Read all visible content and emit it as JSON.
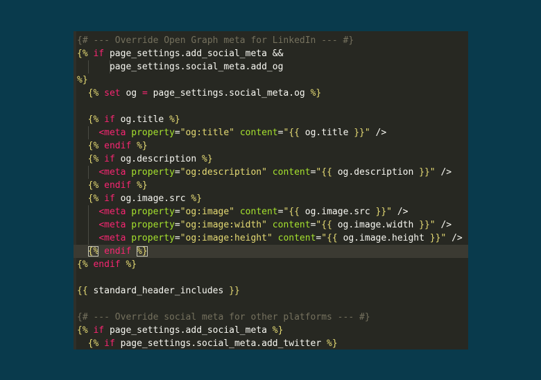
{
  "editor": {
    "lines": [
      {
        "indent": 0,
        "tokens": [
          {
            "t": "{# --- Override Open Graph meta for LinkedIn --- #}",
            "c": "comment"
          }
        ]
      },
      {
        "indent": 0,
        "tokens": [
          {
            "t": "{%",
            "c": "delim"
          },
          {
            "t": " ",
            "c": "var"
          },
          {
            "t": "if",
            "c": "kw"
          },
          {
            "t": " page_settings.add_social_meta ",
            "c": "var"
          },
          {
            "t": "&&",
            "c": "var"
          }
        ]
      },
      {
        "indent": 0,
        "guides": [
          2,
          6
        ],
        "tokens": [
          {
            "t": "      page_settings.social_meta.add_og",
            "c": "var"
          }
        ]
      },
      {
        "indent": 0,
        "tokens": [
          {
            "t": "%}",
            "c": "delim"
          }
        ]
      },
      {
        "indent": 0,
        "tokens": [
          {
            "t": "  ",
            "c": "var"
          },
          {
            "t": "{%",
            "c": "delim"
          },
          {
            "t": " ",
            "c": "var"
          },
          {
            "t": "set",
            "c": "kw"
          },
          {
            "t": " og ",
            "c": "var"
          },
          {
            "t": "=",
            "c": "op"
          },
          {
            "t": " page_settings.social_meta.og ",
            "c": "var"
          },
          {
            "t": "%}",
            "c": "delim"
          }
        ]
      },
      {
        "indent": 0,
        "tokens": [
          {
            "t": " ",
            "c": "var"
          }
        ]
      },
      {
        "indent": 0,
        "tokens": [
          {
            "t": "  ",
            "c": "var"
          },
          {
            "t": "{%",
            "c": "delim"
          },
          {
            "t": " ",
            "c": "var"
          },
          {
            "t": "if",
            "c": "kw"
          },
          {
            "t": " og.title ",
            "c": "var"
          },
          {
            "t": "%}",
            "c": "delim"
          }
        ]
      },
      {
        "indent": 0,
        "guides": [
          2
        ],
        "tokens": [
          {
            "t": "    ",
            "c": "var"
          },
          {
            "t": "<meta",
            "c": "tag"
          },
          {
            "t": " ",
            "c": "var"
          },
          {
            "t": "property",
            "c": "attr"
          },
          {
            "t": "=",
            "c": "punct"
          },
          {
            "t": "\"og:title\"",
            "c": "str"
          },
          {
            "t": " ",
            "c": "var"
          },
          {
            "t": "content",
            "c": "attr"
          },
          {
            "t": "=",
            "c": "punct"
          },
          {
            "t": "\"{{ ",
            "c": "str"
          },
          {
            "t": "og.title",
            "c": "var"
          },
          {
            "t": " }}\"",
            "c": "str"
          },
          {
            "t": " />",
            "c": "punct"
          }
        ]
      },
      {
        "indent": 0,
        "tokens": [
          {
            "t": "  ",
            "c": "var"
          },
          {
            "t": "{%",
            "c": "delim"
          },
          {
            "t": " ",
            "c": "var"
          },
          {
            "t": "endif",
            "c": "kw"
          },
          {
            "t": " ",
            "c": "var"
          },
          {
            "t": "%}",
            "c": "delim"
          }
        ]
      },
      {
        "indent": 0,
        "tokens": [
          {
            "t": "  ",
            "c": "var"
          },
          {
            "t": "{%",
            "c": "delim"
          },
          {
            "t": " ",
            "c": "var"
          },
          {
            "t": "if",
            "c": "kw"
          },
          {
            "t": " og.description ",
            "c": "var"
          },
          {
            "t": "%}",
            "c": "delim"
          }
        ]
      },
      {
        "indent": 0,
        "guides": [
          2
        ],
        "tokens": [
          {
            "t": "    ",
            "c": "var"
          },
          {
            "t": "<meta",
            "c": "tag"
          },
          {
            "t": " ",
            "c": "var"
          },
          {
            "t": "property",
            "c": "attr"
          },
          {
            "t": "=",
            "c": "punct"
          },
          {
            "t": "\"og:description\"",
            "c": "str"
          },
          {
            "t": " ",
            "c": "var"
          },
          {
            "t": "content",
            "c": "attr"
          },
          {
            "t": "=",
            "c": "punct"
          },
          {
            "t": "\"{{ ",
            "c": "str"
          },
          {
            "t": "og.description",
            "c": "var"
          },
          {
            "t": " }}\"",
            "c": "str"
          },
          {
            "t": " />",
            "c": "punct"
          }
        ]
      },
      {
        "indent": 0,
        "tokens": [
          {
            "t": "  ",
            "c": "var"
          },
          {
            "t": "{%",
            "c": "delim"
          },
          {
            "t": " ",
            "c": "var"
          },
          {
            "t": "endif",
            "c": "kw"
          },
          {
            "t": " ",
            "c": "var"
          },
          {
            "t": "%}",
            "c": "delim"
          }
        ]
      },
      {
        "indent": 0,
        "tokens": [
          {
            "t": "  ",
            "c": "var"
          },
          {
            "t": "{%",
            "c": "delim"
          },
          {
            "t": " ",
            "c": "var"
          },
          {
            "t": "if",
            "c": "kw"
          },
          {
            "t": " og.image.src ",
            "c": "var"
          },
          {
            "t": "%}",
            "c": "delim"
          }
        ]
      },
      {
        "indent": 0,
        "guides": [
          2
        ],
        "tokens": [
          {
            "t": "    ",
            "c": "var"
          },
          {
            "t": "<meta",
            "c": "tag"
          },
          {
            "t": " ",
            "c": "var"
          },
          {
            "t": "property",
            "c": "attr"
          },
          {
            "t": "=",
            "c": "punct"
          },
          {
            "t": "\"og:image\"",
            "c": "str"
          },
          {
            "t": " ",
            "c": "var"
          },
          {
            "t": "content",
            "c": "attr"
          },
          {
            "t": "=",
            "c": "punct"
          },
          {
            "t": "\"{{ ",
            "c": "str"
          },
          {
            "t": "og.image.src",
            "c": "var"
          },
          {
            "t": " }}\"",
            "c": "str"
          },
          {
            "t": " />",
            "c": "punct"
          }
        ]
      },
      {
        "indent": 0,
        "guides": [
          2
        ],
        "tokens": [
          {
            "t": "    ",
            "c": "var"
          },
          {
            "t": "<meta",
            "c": "tag"
          },
          {
            "t": " ",
            "c": "var"
          },
          {
            "t": "property",
            "c": "attr"
          },
          {
            "t": "=",
            "c": "punct"
          },
          {
            "t": "\"og:image:width\"",
            "c": "str"
          },
          {
            "t": " ",
            "c": "var"
          },
          {
            "t": "content",
            "c": "attr"
          },
          {
            "t": "=",
            "c": "punct"
          },
          {
            "t": "\"{{ ",
            "c": "str"
          },
          {
            "t": "og.image.width",
            "c": "var"
          },
          {
            "t": " }}\"",
            "c": "str"
          },
          {
            "t": " />",
            "c": "punct"
          }
        ]
      },
      {
        "indent": 0,
        "guides": [
          2
        ],
        "tokens": [
          {
            "t": "    ",
            "c": "var"
          },
          {
            "t": "<meta",
            "c": "tag"
          },
          {
            "t": " ",
            "c": "var"
          },
          {
            "t": "property",
            "c": "attr"
          },
          {
            "t": "=",
            "c": "punct"
          },
          {
            "t": "\"og:image:height\"",
            "c": "str"
          },
          {
            "t": " ",
            "c": "var"
          },
          {
            "t": "content",
            "c": "attr"
          },
          {
            "t": "=",
            "c": "punct"
          },
          {
            "t": "\"{{ ",
            "c": "str"
          },
          {
            "t": "og.image.height",
            "c": "var"
          },
          {
            "t": " }}\"",
            "c": "str"
          },
          {
            "t": " />",
            "c": "punct"
          }
        ]
      },
      {
        "indent": 0,
        "current": true,
        "tokens": [
          {
            "t": "  ",
            "c": "var"
          },
          {
            "t": "{%",
            "c": "delim",
            "match": true
          },
          {
            "t": " ",
            "c": "var"
          },
          {
            "t": "endif",
            "c": "kw"
          },
          {
            "t": " ",
            "c": "var"
          },
          {
            "t": "%}",
            "c": "delim",
            "match": true
          }
        ]
      },
      {
        "indent": 0,
        "tokens": [
          {
            "t": "{%",
            "c": "delim"
          },
          {
            "t": " ",
            "c": "var"
          },
          {
            "t": "endif",
            "c": "kw"
          },
          {
            "t": " ",
            "c": "var"
          },
          {
            "t": "%}",
            "c": "delim"
          }
        ]
      },
      {
        "indent": 0,
        "tokens": [
          {
            "t": " ",
            "c": "var"
          }
        ]
      },
      {
        "indent": 0,
        "tokens": [
          {
            "t": "{{",
            "c": "delim"
          },
          {
            "t": " standard_header_includes ",
            "c": "var"
          },
          {
            "t": "}}",
            "c": "delim"
          }
        ]
      },
      {
        "indent": 0,
        "tokens": [
          {
            "t": " ",
            "c": "var"
          }
        ]
      },
      {
        "indent": 0,
        "tokens": [
          {
            "t": "{# --- Override social meta for other platforms --- #}",
            "c": "comment"
          }
        ]
      },
      {
        "indent": 0,
        "tokens": [
          {
            "t": "{%",
            "c": "delim"
          },
          {
            "t": " ",
            "c": "var"
          },
          {
            "t": "if",
            "c": "kw"
          },
          {
            "t": " page_settings.add_social_meta ",
            "c": "var"
          },
          {
            "t": "%}",
            "c": "delim"
          }
        ]
      },
      {
        "indent": 0,
        "tokens": [
          {
            "t": "  ",
            "c": "var"
          },
          {
            "t": "{%",
            "c": "delim"
          },
          {
            "t": " ",
            "c": "var"
          },
          {
            "t": "if",
            "c": "kw"
          },
          {
            "t": " page_settings.social_meta.add_twitter ",
            "c": "var"
          },
          {
            "t": "%}",
            "c": "delim"
          }
        ]
      }
    ],
    "colors": {
      "background": "#272822",
      "page_background": "#093a4c",
      "comment": "#75715e",
      "keyword": "#f92672",
      "delimiter": "#e6db74",
      "attribute": "#a6e22e",
      "text": "#f8f8f2"
    }
  }
}
